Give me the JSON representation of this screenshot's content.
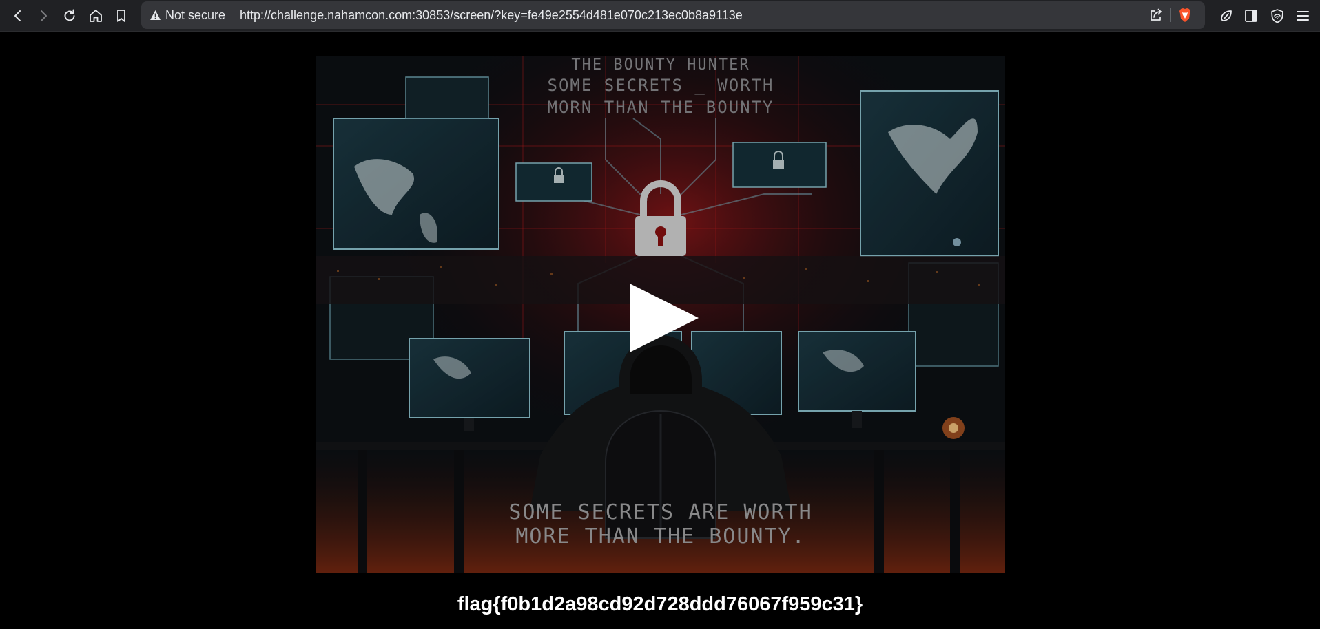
{
  "browser": {
    "security_label": "Not secure",
    "url": "http://challenge.nahamcon.com:30853/screen/?key=fe49e2554d481e070c213ec0b8a9113e",
    "nav_icons": [
      "back-icon",
      "forward-icon",
      "reload-icon",
      "home-icon",
      "bookmark-icon"
    ],
    "omnibox_icons": [
      "warning-icon",
      "share-icon",
      "brave-shields-icon"
    ],
    "toolbar_icons": [
      "leo-ai-icon",
      "sidebar-icon",
      "vpn-icon",
      "menu-icon"
    ],
    "accent": "#fb542b"
  },
  "video": {
    "poster": {
      "top_title": "THE BOUNTY HUNTER",
      "top_line1": "SOME SECRETS _ WORTH",
      "top_line2": "MORN THAN THE BOUNTY",
      "bottom_line1": "SOME SECRETS ARE WORTH",
      "bottom_line2": "MORE THAN THE BOUNTY."
    },
    "play_icon": "play-icon"
  },
  "flag": "flag{f0b1d2a98cd92d728ddd76067f959c31}"
}
